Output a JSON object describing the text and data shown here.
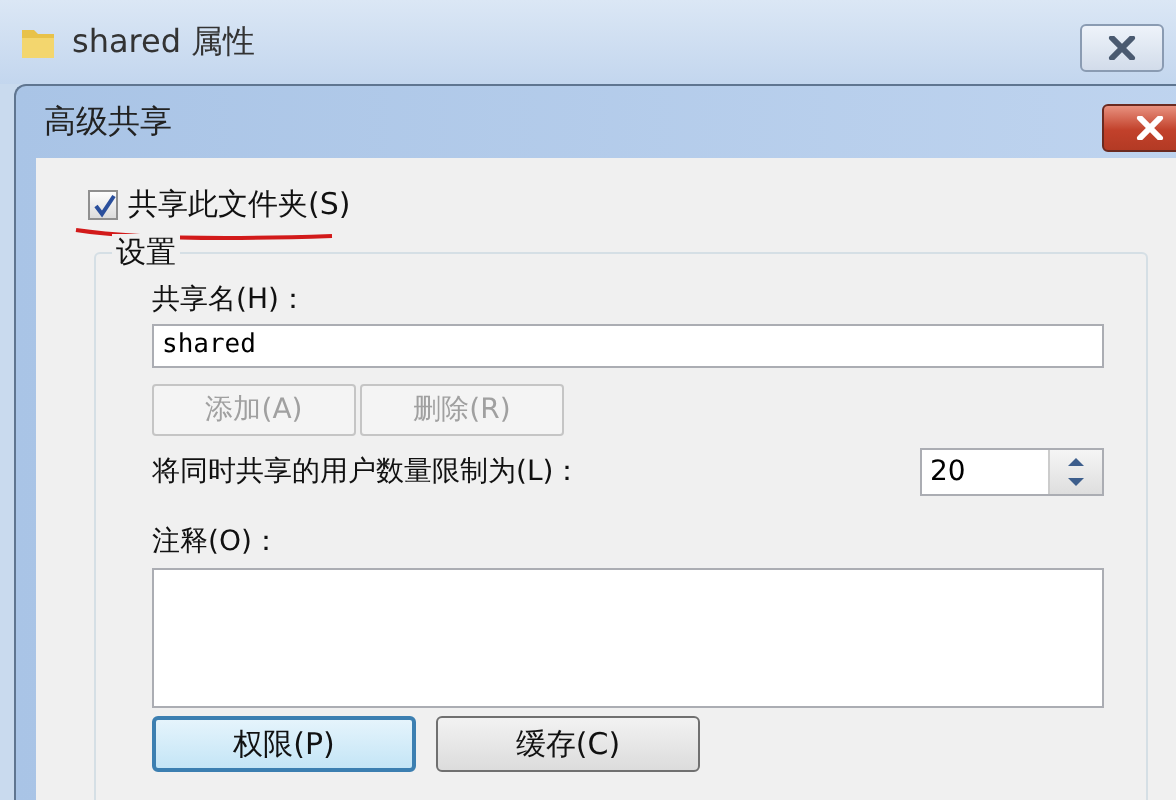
{
  "window": {
    "title": "shared 属性"
  },
  "dialog": {
    "title": "高级共享",
    "share_checkbox": {
      "label": "共享此文件夹(S)",
      "checked": true
    },
    "settings": {
      "title": "设置",
      "share_name_label": "共享名(H)：",
      "share_name": "shared",
      "name_buttons": [
        {
          "label": "添加(A)",
          "disabled": true
        },
        {
          "label": "删除(R)",
          "disabled": true
        }
      ],
      "limit_label": "将同时共享的用户数量限制为(L)：",
      "limit_value": "20",
      "comment_label": "注释(O)："
    },
    "buttons": [
      {
        "label": "权限(P)",
        "focused": true
      },
      {
        "label": "缓存(C)",
        "focused": false
      }
    ]
  }
}
